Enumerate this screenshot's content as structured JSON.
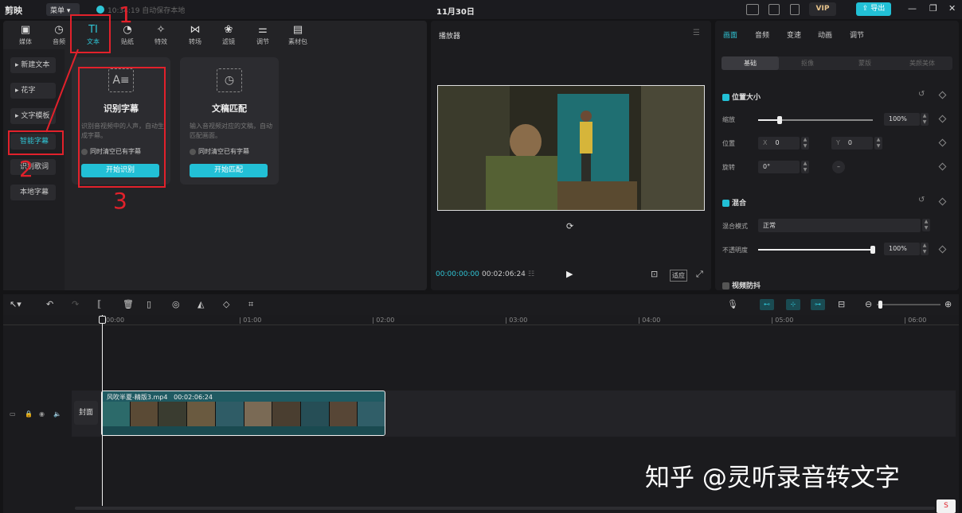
{
  "titlebar": {
    "app_name": "剪映",
    "menu_label": "菜单",
    "autosave_text": "10:34:19 自动保存本地",
    "project_date": "11月30日",
    "vip_label": "VIP",
    "export_label": "导出"
  },
  "media_tabs": [
    {
      "label": "媒体",
      "icon": "media-icon"
    },
    {
      "label": "音频",
      "icon": "audio-icon"
    },
    {
      "label": "文本",
      "icon": "text-icon",
      "active": true
    },
    {
      "label": "贴纸",
      "icon": "sticker-icon"
    },
    {
      "label": "特效",
      "icon": "effects-icon"
    },
    {
      "label": "转场",
      "icon": "transition-icon"
    },
    {
      "label": "滤镜",
      "icon": "filter-icon"
    },
    {
      "label": "调节",
      "icon": "adjust-icon"
    },
    {
      "label": "素材包",
      "icon": "package-icon"
    }
  ],
  "text_sidebar": [
    {
      "label": "新建文本"
    },
    {
      "label": "花字"
    },
    {
      "label": "文字模板"
    },
    {
      "label": "智能字幕",
      "active": true
    },
    {
      "label": "识别歌词"
    },
    {
      "label": "本地字幕"
    }
  ],
  "cards": [
    {
      "title": "识别字幕",
      "description": "识别音视频中的人声，自动生成字幕。",
      "checkbox_label": "同时清空已有字幕",
      "button_label": "开始识别"
    },
    {
      "title": "文稿匹配",
      "description": "输入音视频对应的文稿，自动匹配画面。",
      "checkbox_label": "同时清空已有字幕",
      "button_label": "开始匹配"
    }
  ],
  "player": {
    "title": "播放器",
    "current_time": "00:00:00:00",
    "total_time": "00:02:06:24",
    "fit_label": "适应"
  },
  "inspector": {
    "tabs": [
      "画面",
      "音频",
      "变速",
      "动画",
      "调节"
    ],
    "segments": [
      "基础",
      "抠像",
      "蒙版",
      "美颜美体"
    ],
    "position_size_title": "位置大小",
    "scale_label": "缩放",
    "scale_value": "100%",
    "scale_fraction": 0.19,
    "position_label": "位置",
    "x_label": "X",
    "x_value": "0",
    "y_label": "Y",
    "y_value": "0",
    "rotate_label": "旋转",
    "rotate_value": "0°",
    "blend_title": "混合",
    "blend_mode_label": "混合模式",
    "blend_mode_value": "正常",
    "opacity_label": "不透明度",
    "opacity_value": "100%",
    "opacity_fraction": 1.0,
    "stabilize_title": "视频防抖"
  },
  "timeline": {
    "ticks": [
      "00:00",
      "01:00",
      "02:00",
      "03:00",
      "04:00",
      "05:00",
      "06:00"
    ],
    "cover_label": "封面",
    "clip_name": "风吹半夏-精版3.mp4",
    "clip_duration": "00:02:06:24"
  },
  "annotations": {
    "step1": "1",
    "step2": "2",
    "step3": "3"
  },
  "watermark": "知乎 @灵听录音转文字",
  "colors": {
    "accent": "#22c0d6",
    "annotation_red": "#e2212b",
    "panel_bg": "#232326"
  }
}
